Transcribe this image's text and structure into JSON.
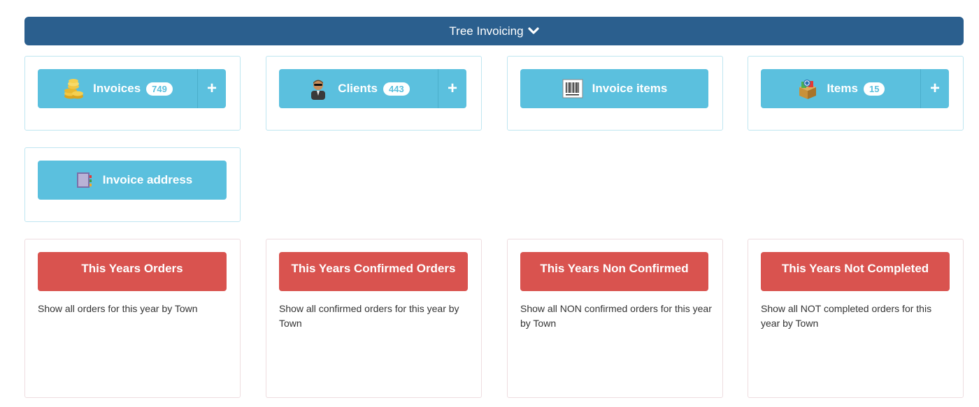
{
  "header": {
    "title": "Tree Invoicing"
  },
  "tiles": [
    {
      "label": "Invoices",
      "badge": "749",
      "icon": "coins-icon",
      "has_add": true
    },
    {
      "label": "Clients",
      "badge": "443",
      "icon": "person-icon",
      "has_add": true
    },
    {
      "label": "Invoice items",
      "icon": "barcode-icon",
      "has_add": false
    },
    {
      "label": "Items",
      "badge": "15",
      "icon": "box-icon",
      "has_add": true
    },
    {
      "label": "Invoice address",
      "icon": "address-book-icon",
      "has_add": false
    }
  ],
  "add_symbol": "+",
  "reports": [
    {
      "title": "This Years Orders",
      "description": "Show all orders for this year by Town"
    },
    {
      "title": "This Years Confirmed Orders",
      "description": "Show all confirmed orders for this year by Town"
    },
    {
      "title": "This Years Non Confirmed",
      "description": "Show all NON confirmed orders for this year by Town"
    },
    {
      "title": "This Years Not Completed",
      "description": "Show all NOT completed orders for this year by Town"
    }
  ],
  "colors": {
    "header": "#2b5f8e",
    "tile": "#5bc0de",
    "report": "#d9534f"
  }
}
